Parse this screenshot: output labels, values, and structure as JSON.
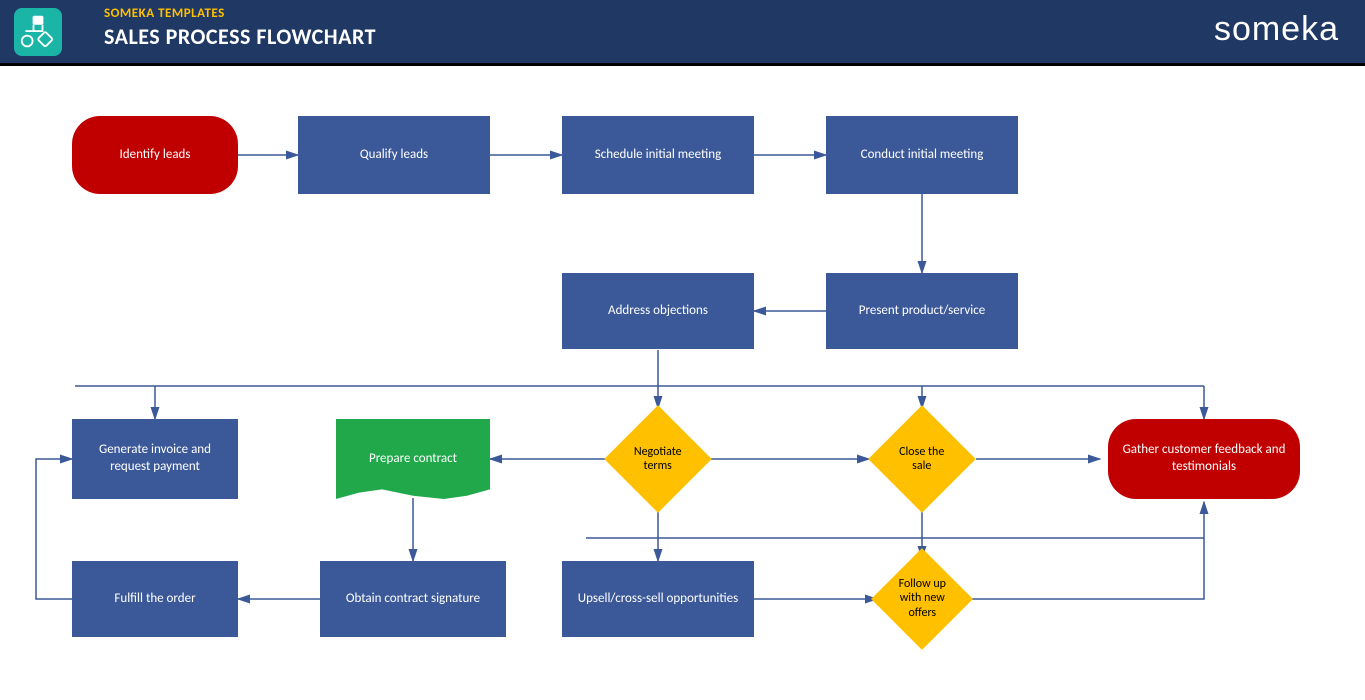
{
  "header": {
    "sub": "SOMEKA TEMPLATES",
    "title": "SALES PROCESS FLOWCHART",
    "brand": "someka"
  },
  "nodes": {
    "identify": "Identify leads",
    "qualify": "Qualify leads",
    "schedule": "Schedule initial meeting",
    "conduct": "Conduct initial meeting",
    "present": "Present product/service",
    "address": "Address objections",
    "negotiate": "Negotiate terms",
    "close": "Close the sale",
    "prepare": "Prepare contract",
    "invoice": "Generate invoice and request payment",
    "gather": "Gather customer feedback and testimonials",
    "fulfill": "Fulfill the order",
    "obtain": "Obtain contract signature",
    "upsell": "Upsell/cross-sell opportunities",
    "followup": "Follow up with new offers"
  }
}
